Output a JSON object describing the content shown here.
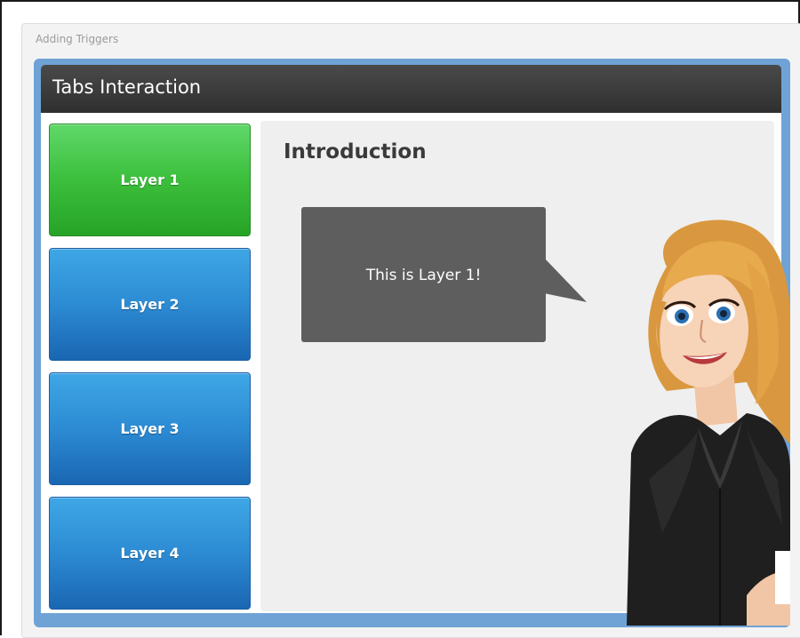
{
  "course": {
    "title": "Adding Triggers"
  },
  "slide": {
    "header_title": "Tabs Interaction",
    "tabs": [
      {
        "label": "Layer 1",
        "state": "active",
        "color": "#3cbf3c"
      },
      {
        "label": "Layer 2",
        "state": "inactive",
        "color": "#2c8bd3"
      },
      {
        "label": "Layer 3",
        "state": "inactive",
        "color": "#2c8bd3"
      },
      {
        "label": "Layer 4",
        "state": "inactive",
        "color": "#2c8bd3"
      }
    ],
    "content": {
      "heading": "Introduction",
      "speech_bubble": "This is Layer 1!"
    }
  },
  "colors": {
    "frame_blue": "#6fa3d6",
    "header_dark": "#3a3a3a",
    "bubble_gray": "#5e5e5e"
  },
  "icons": {
    "character": "cartoon-woman-illustration"
  }
}
